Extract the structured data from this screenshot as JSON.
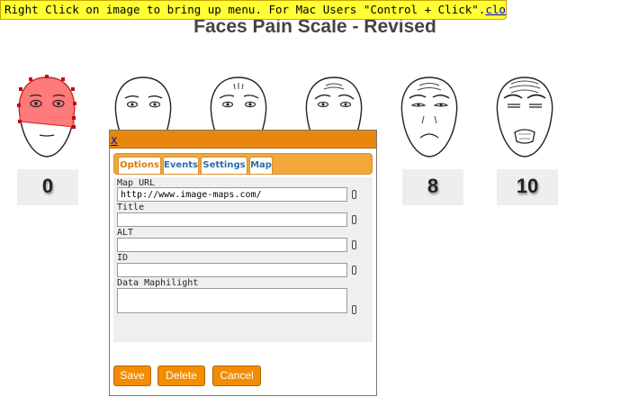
{
  "hint_bar": {
    "text": "Right Click on image to bring up menu. For Mac Users \"Control + Click\".",
    "link": "close"
  },
  "title": "Faces Pain Scale - Revised",
  "scores": [
    "0",
    "8",
    "10"
  ],
  "dialog": {
    "close_label": "X",
    "tabs": [
      "Options",
      "Events",
      "Settings",
      "Map"
    ],
    "active_tab": "Options",
    "fields": {
      "map_url": {
        "label": "Map URL",
        "value": "http://www.image-maps.com/"
      },
      "title": {
        "label": "Title",
        "value": ""
      },
      "alt": {
        "label": "ALT",
        "value": ""
      },
      "id": {
        "label": "ID",
        "value": ""
      },
      "data_maphilight": {
        "label": "Data Maphilight",
        "value": ""
      }
    },
    "buttons": {
      "save": "Save",
      "delete": "Delete",
      "cancel": "Cancel"
    }
  },
  "colors": {
    "hint_bg": "#ffff33",
    "accent": "#f28c00",
    "dialog_header": "#e8870e",
    "highlight": "#ff4d4d"
  }
}
